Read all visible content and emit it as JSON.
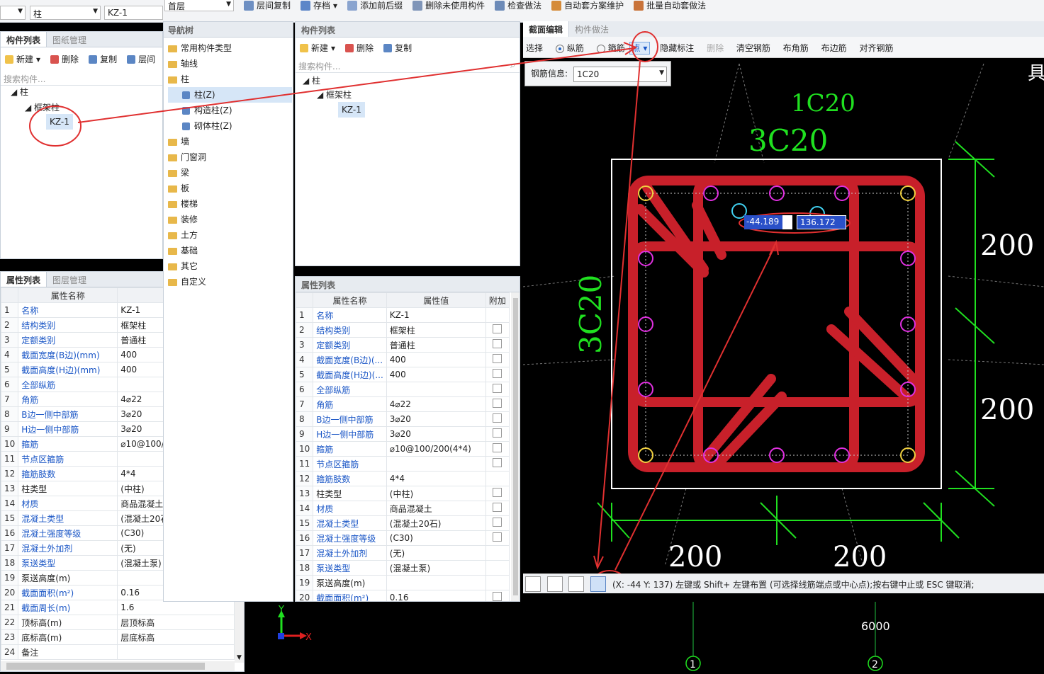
{
  "top": {
    "floor_select": "首层",
    "left_select1": "",
    "left_select2": "柱",
    "left_select3": "KZ-1",
    "toolbar": [
      "层间复制",
      "存档",
      "添加前后缀",
      "删除未使用构件",
      "检查做法",
      "自动套方案维护",
      "批量自动套做法"
    ]
  },
  "left_panel": {
    "tabs": [
      "构件列表",
      "图纸管理"
    ],
    "actions": [
      "新建",
      "删除",
      "复制",
      "层间"
    ],
    "search_placeholder": "搜索构件...",
    "tree": {
      "root": "柱",
      "group": "框架柱",
      "item": "KZ-1"
    }
  },
  "left_props": {
    "tabs": [
      "属性列表",
      "图层管理"
    ],
    "headers": [
      "属性名称",
      "属"
    ],
    "rows": [
      {
        "n": "1",
        "name": "名称",
        "value": "KZ-1",
        "blue": true
      },
      {
        "n": "2",
        "name": "结构类别",
        "value": "框架柱",
        "blue": true
      },
      {
        "n": "3",
        "name": "定额类别",
        "value": "普通柱",
        "blue": true
      },
      {
        "n": "4",
        "name": "截面宽度(B边)(mm)",
        "value": "400",
        "blue": true
      },
      {
        "n": "5",
        "name": "截面高度(H边)(mm)",
        "value": "400",
        "blue": true
      },
      {
        "n": "6",
        "name": "全部纵筋",
        "value": "",
        "blue": true
      },
      {
        "n": "7",
        "name": "角筋",
        "value": "4⌀22",
        "blue": true
      },
      {
        "n": "8",
        "name": "B边一侧中部筋",
        "value": "3⌀20",
        "blue": true
      },
      {
        "n": "9",
        "name": "H边一侧中部筋",
        "value": "3⌀20",
        "blue": true
      },
      {
        "n": "10",
        "name": "箍筋",
        "value": "⌀10@100/",
        "blue": true
      },
      {
        "n": "11",
        "name": "节点区箍筋",
        "value": "",
        "blue": true
      },
      {
        "n": "12",
        "name": "箍筋肢数",
        "value": "4*4",
        "blue": true
      },
      {
        "n": "13",
        "name": "柱类型",
        "value": "(中柱)",
        "blue": false
      },
      {
        "n": "14",
        "name": "材质",
        "value": "商品混凝土",
        "blue": true
      },
      {
        "n": "15",
        "name": "混凝土类型",
        "value": "(混凝土20石",
        "blue": true
      },
      {
        "n": "16",
        "name": "混凝土强度等级",
        "value": "(C30)",
        "blue": true
      },
      {
        "n": "17",
        "name": "混凝土外加剂",
        "value": "(无)",
        "blue": true
      },
      {
        "n": "18",
        "name": "泵送类型",
        "value": "(混凝土泵)",
        "blue": true
      },
      {
        "n": "19",
        "name": "泵送高度(m)",
        "value": "",
        "blue": false
      },
      {
        "n": "20",
        "name": "截面面积(m²)",
        "value": "0.16",
        "blue": true
      },
      {
        "n": "21",
        "name": "截面周长(m)",
        "value": "1.6",
        "blue": true
      },
      {
        "n": "22",
        "name": "顶标高(m)",
        "value": "层顶标高",
        "blue": false
      },
      {
        "n": "23",
        "name": "底标高(m)",
        "value": "层底标高",
        "blue": false
      },
      {
        "n": "24",
        "name": "备注",
        "value": "",
        "blue": false
      }
    ]
  },
  "nav_tree": {
    "title": "导航树",
    "items": [
      "常用构件类型",
      "轴线",
      "柱",
      "柱(Z)",
      "构造柱(Z)",
      "砌体柱(Z)",
      "墙",
      "门窗洞",
      "梁",
      "板",
      "楼梯",
      "装修",
      "土方",
      "基础",
      "其它",
      "自定义"
    ]
  },
  "mid_list": {
    "title": "构件列表",
    "actions": [
      "新建",
      "删除",
      "复制"
    ],
    "search_placeholder": "搜索构件...",
    "tree": {
      "root": "柱",
      "group": "框架柱",
      "item": "KZ-1"
    }
  },
  "mid_props": {
    "title": "属性列表",
    "headers": [
      "属性名称",
      "属性值",
      "附加"
    ],
    "rows": [
      {
        "n": "1",
        "name": "名称",
        "value": "KZ-1",
        "blue": true,
        "chk": false
      },
      {
        "n": "2",
        "name": "结构类别",
        "value": "框架柱",
        "blue": true,
        "chk": true
      },
      {
        "n": "3",
        "name": "定额类别",
        "value": "普通柱",
        "blue": true,
        "chk": true
      },
      {
        "n": "4",
        "name": "截面宽度(B边)(...",
        "value": "400",
        "blue": true,
        "chk": true
      },
      {
        "n": "5",
        "name": "截面高度(H边)(...",
        "value": "400",
        "blue": true,
        "chk": true
      },
      {
        "n": "6",
        "name": "全部纵筋",
        "value": "",
        "blue": true,
        "chk": true
      },
      {
        "n": "7",
        "name": "角筋",
        "value": "4⌀22",
        "blue": true,
        "chk": true
      },
      {
        "n": "8",
        "name": "B边一侧中部筋",
        "value": "3⌀20",
        "blue": true,
        "chk": true
      },
      {
        "n": "9",
        "name": "H边一侧中部筋",
        "value": "3⌀20",
        "blue": true,
        "chk": true
      },
      {
        "n": "10",
        "name": "箍筋",
        "value": "⌀10@100/200(4*4)",
        "blue": true,
        "chk": true
      },
      {
        "n": "11",
        "name": "节点区箍筋",
        "value": "",
        "blue": true,
        "chk": true
      },
      {
        "n": "12",
        "name": "箍筋肢数",
        "value": "4*4",
        "blue": true,
        "chk": false
      },
      {
        "n": "13",
        "name": "柱类型",
        "value": "(中柱)",
        "blue": false,
        "chk": true
      },
      {
        "n": "14",
        "name": "材质",
        "value": "商品混凝土",
        "blue": true,
        "chk": true
      },
      {
        "n": "15",
        "name": "混凝土类型",
        "value": "(混凝土20石)",
        "blue": true,
        "chk": true
      },
      {
        "n": "16",
        "name": "混凝土强度等级",
        "value": "(C30)",
        "blue": true,
        "chk": true
      },
      {
        "n": "17",
        "name": "混凝土外加剂",
        "value": "(无)",
        "blue": true,
        "chk": false
      },
      {
        "n": "18",
        "name": "泵送类型",
        "value": "(混凝土泵)",
        "blue": true,
        "chk": false
      },
      {
        "n": "19",
        "name": "泵送高度(m)",
        "value": "",
        "blue": false,
        "chk": false
      },
      {
        "n": "20",
        "name": "截面面积(m²)",
        "value": "0.16",
        "blue": true,
        "chk": true
      }
    ]
  },
  "editor": {
    "tabs": [
      "截面编辑",
      "构件做法"
    ],
    "toolbar": {
      "select": "选择",
      "radio1": "纵筋",
      "radio2": "箍筋",
      "mode": "点",
      "hide": "隐藏标注",
      "delete": "删除",
      "clear": "清空钢筋",
      "corner": "布角筋",
      "edge": "布边筋",
      "align": "对齐钢筋"
    },
    "rebar_label": "钢筋信息:",
    "rebar_value": "1C20",
    "labels": {
      "top1": "1C20",
      "top2": "3C20",
      "left": "3C20",
      "dim_r1": "200",
      "dim_r2": "200",
      "dim_b1": "200",
      "dim_b2": "200",
      "corner_mark": "具"
    },
    "coord_x": "-44.189",
    "coord_y": "136.172",
    "status": "(X: -44 Y: 137)  左键或 Shift+ 左键布置 (可选择线筋端点或中心点);按右键中止或 ESC 键取消;"
  },
  "canvas": {
    "axis_x": "X",
    "axis_y": "Y",
    "dim": "6000",
    "axis1": "1",
    "axis2": "2"
  }
}
